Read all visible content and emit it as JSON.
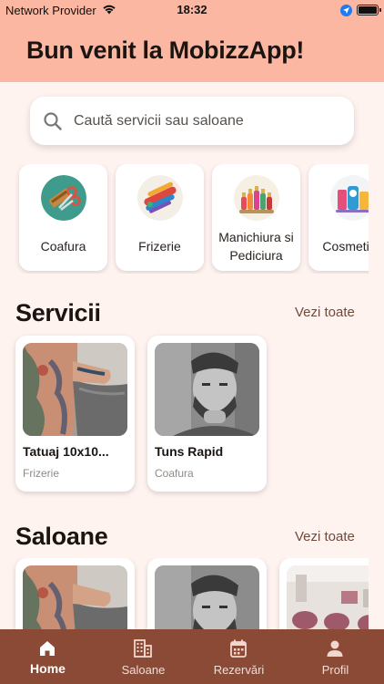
{
  "status_bar": {
    "carrier": "Network Provider",
    "time": "18:32",
    "battery_level": 1.0
  },
  "header": {
    "title": "Bun venit la MobizzApp!",
    "background_color": "#FBB7A1"
  },
  "search": {
    "placeholder": "Caută servicii sau saloane",
    "value": ""
  },
  "categories": [
    {
      "label": "Coafura",
      "icon": "scissors-comb-icon"
    },
    {
      "label": "Frizerie",
      "icon": "razor-tools-icon"
    },
    {
      "label": "Manichiura si Pediciura",
      "icon": "nail-polish-icon"
    },
    {
      "label": "Cosmetica",
      "icon": "cosmetics-icon"
    }
  ],
  "services_section": {
    "title": "Servicii",
    "see_all": "Vezi toate",
    "items": [
      {
        "title": "Tatuaj 10x10...",
        "category": "Frizerie",
        "image": "tattooed-woman-photo"
      },
      {
        "title": "Tuns Rapid",
        "category": "Coafura",
        "image": "bearded-man-photo"
      }
    ]
  },
  "salons_section": {
    "title": "Saloane",
    "see_all": "Vezi toate",
    "items": [
      {
        "image": "tattooed-woman-photo"
      },
      {
        "image": "bearded-man-photo"
      },
      {
        "image": "salon-interior-photo"
      }
    ]
  },
  "bottom_nav": {
    "active": "Home",
    "items": [
      {
        "label": "Home",
        "icon": "home-icon"
      },
      {
        "label": "Saloane",
        "icon": "building-icon"
      },
      {
        "label": "Rezervări",
        "icon": "calendar-icon"
      },
      {
        "label": "Profil",
        "icon": "person-icon"
      }
    ],
    "background_color": "#8A4A35"
  }
}
